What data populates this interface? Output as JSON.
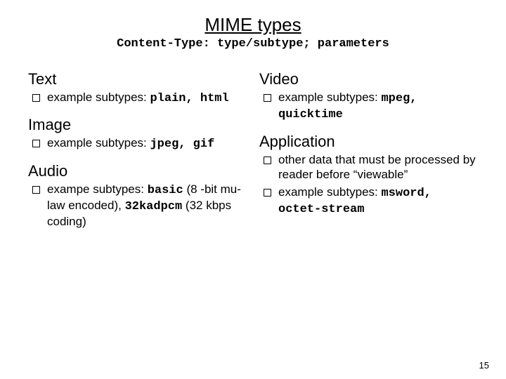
{
  "title": "MIME types",
  "subtitle": "Content-Type: type/subtype; parameters",
  "left": {
    "s1": {
      "head": "Text",
      "b1_pre": "example subtypes: ",
      "b1_code": "plain, html"
    },
    "s2": {
      "head": "Image",
      "b1_pre": "example subtypes: ",
      "b1_code": "jpeg, gif"
    },
    "s3": {
      "head": "Audio",
      "b1_pre": "exampe subtypes: ",
      "b1_code1": "basic",
      "b1_mid": " (8 -bit mu-law encoded), ",
      "b1_code2": "32kadpcm",
      "b1_post": " (32 kbps coding)"
    }
  },
  "right": {
    "s1": {
      "head": "Video",
      "b1_pre": "example subtypes: ",
      "b1_code": "mpeg, quicktime"
    },
    "s2": {
      "head": "Application",
      "b1": "other data that must be processed by reader before “viewable”",
      "b2_pre": "example subtypes: ",
      "b2_code": "msword, octet-stream"
    }
  },
  "page_number": "15"
}
